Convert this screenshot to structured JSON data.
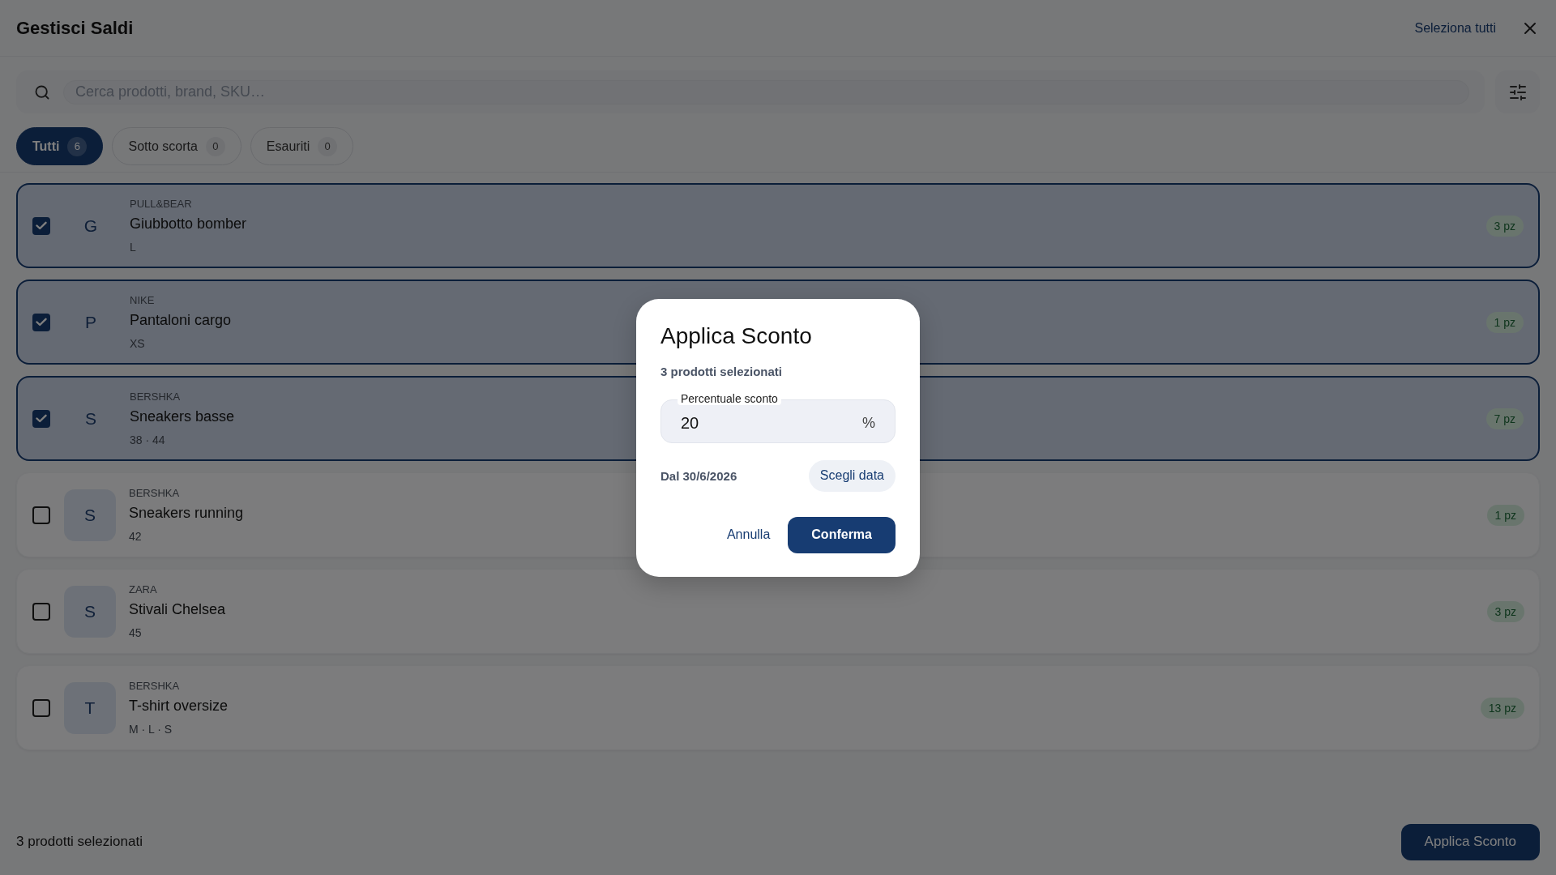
{
  "header": {
    "title": "Gestisci Saldi",
    "select_all": "Seleziona tutti"
  },
  "search": {
    "placeholder": "Cerca prodotti, brand, SKU…"
  },
  "filters": [
    {
      "label": "Tutti",
      "count": "6",
      "selected": true
    },
    {
      "label": "Sotto scorta",
      "count": "0",
      "selected": false
    },
    {
      "label": "Esauriti",
      "count": "0",
      "selected": false
    }
  ],
  "products": [
    {
      "initial": "G",
      "brand": "PULL&BEAR",
      "name": "Giubbotto bomber",
      "sizes": "L",
      "stock": "3 pz",
      "checked": true
    },
    {
      "initial": "P",
      "brand": "NIKE",
      "name": "Pantaloni cargo",
      "sizes": "XS",
      "stock": "1 pz",
      "checked": true
    },
    {
      "initial": "S",
      "brand": "BERSHKA",
      "name": "Sneakers basse",
      "sizes": "38 · 44",
      "stock": "7 pz",
      "checked": true
    },
    {
      "initial": "S",
      "brand": "BERSHKA",
      "name": "Sneakers running",
      "sizes": "42",
      "stock": "1 pz",
      "checked": false
    },
    {
      "initial": "S",
      "brand": "ZARA",
      "name": "Stivali Chelsea",
      "sizes": "45",
      "stock": "3 pz",
      "checked": false
    },
    {
      "initial": "T",
      "brand": "BERSHKA",
      "name": "T-shirt oversize",
      "sizes": "M · L · S",
      "stock": "13 pz",
      "checked": false
    }
  ],
  "footer": {
    "summary": "3 prodotti selezionati",
    "button": "Applica Sconto"
  },
  "dialog": {
    "title": "Applica Sconto",
    "subtitle": "3 prodotti selezionati",
    "field": {
      "label": "Percentuale sconto",
      "value": "20",
      "suffix": "%"
    },
    "date": "Dal 30/6/2026",
    "date_button": "Scegli data",
    "buttons": [
      {
        "label": "Annulla",
        "kind": "text"
      },
      {
        "label": "Conferma",
        "kind": "primary"
      }
    ]
  }
}
